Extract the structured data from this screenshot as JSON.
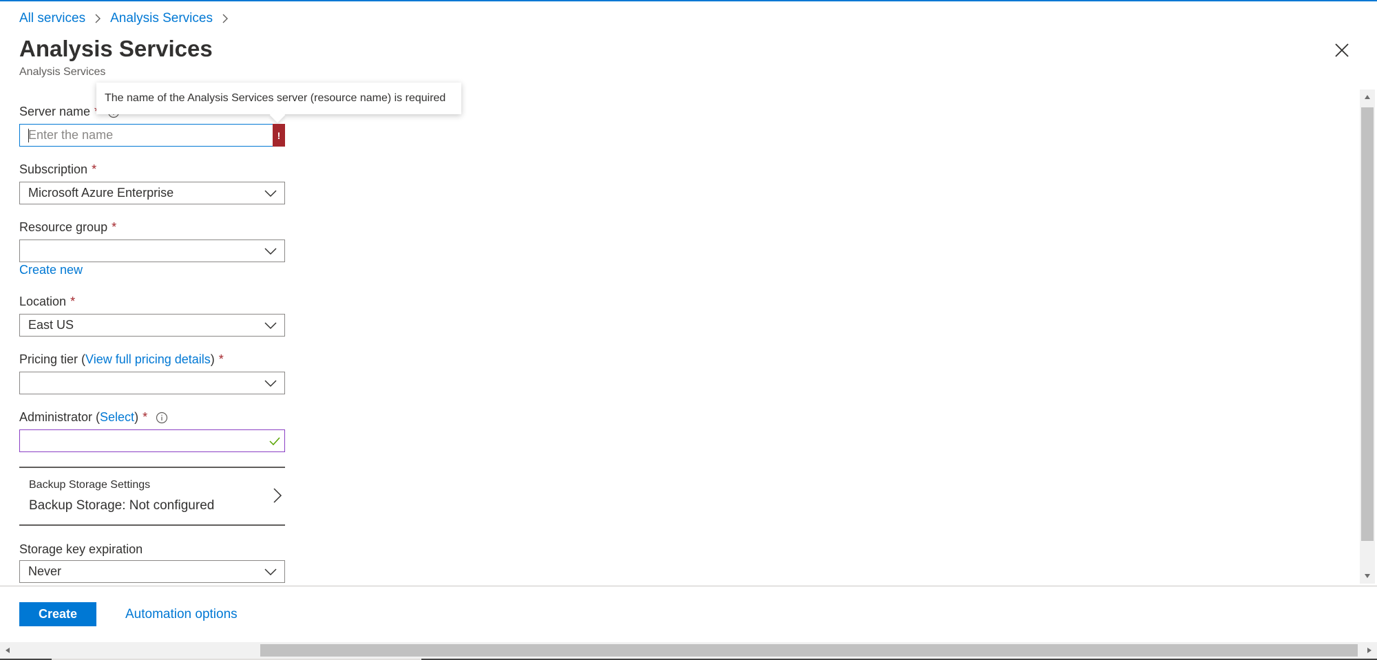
{
  "breadcrumb": {
    "items": [
      "All services",
      "Analysis Services"
    ]
  },
  "header": {
    "title": "Analysis Services",
    "subtitle": "Analysis Services"
  },
  "tooltip": {
    "text": "The name of the Analysis Services server (resource name) is required"
  },
  "form": {
    "server_name": {
      "label": "Server name",
      "required_mark": "*",
      "placeholder": "Enter the name",
      "value": "",
      "error_glyph": "!"
    },
    "subscription": {
      "label": "Subscription",
      "required_mark": "*",
      "value": "Microsoft Azure Enterprise"
    },
    "resource_group": {
      "label": "Resource group",
      "required_mark": "*",
      "value": "",
      "create_new_label": "Create new"
    },
    "location": {
      "label": "Location",
      "required_mark": "*",
      "value": "East US"
    },
    "pricing_tier": {
      "label_prefix": "Pricing tier (",
      "link_text": "View full pricing details",
      "label_suffix": ")",
      "required_mark": "*",
      "value": ""
    },
    "administrator": {
      "label_prefix": "Administrator (",
      "link_text": "Select",
      "label_suffix": ")",
      "required_mark": "*",
      "value": ""
    },
    "backup_storage": {
      "title": "Backup Storage Settings",
      "value": "Backup Storage: Not configured"
    },
    "storage_key_expiration": {
      "label": "Storage key expiration",
      "value": "Never"
    }
  },
  "footer": {
    "create_label": "Create",
    "automation_label": "Automation options"
  },
  "colors": {
    "accent": "#0078d4",
    "error": "#a4262c",
    "success": "#57a300",
    "admin_border": "#8a3ec4"
  },
  "icons": {
    "breadcrumb_separator": "chevron-right-icon",
    "close": "close-icon",
    "info": "info-icon",
    "dropdown": "chevron-down-icon",
    "valid": "checkmark-icon",
    "section_expand": "chevron-right-icon"
  }
}
